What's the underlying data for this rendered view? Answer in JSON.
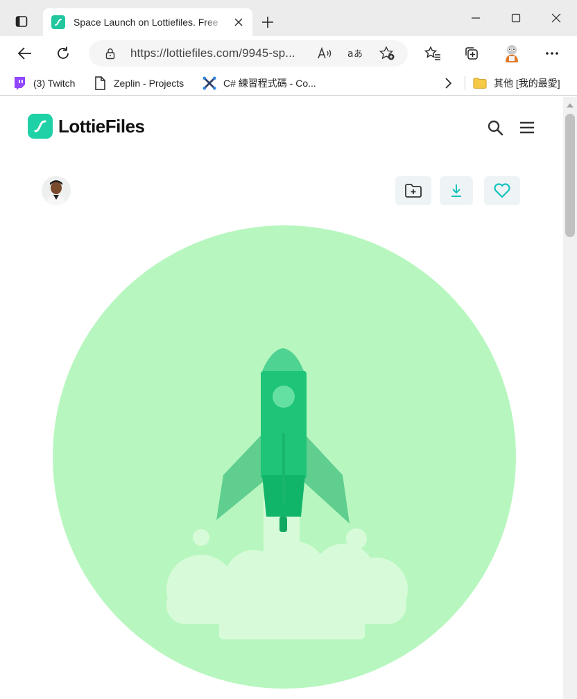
{
  "browser": {
    "tab_title": "Space Launch on Lottiefiles. Free",
    "url": "https://lottiefiles.com/9945-sp...",
    "read_aloud_label": "A̵",
    "translate_label": "aあ",
    "bookmarks": [
      {
        "label": "(3) Twitch",
        "icon": "twitch-icon"
      },
      {
        "label": "Zeplin - Projects",
        "icon": "document-icon"
      },
      {
        "label": "C# 練習程式碼 - Co...",
        "icon": "cross-logo-icon"
      }
    ],
    "other_favorites_label": "其他 [我的最愛]"
  },
  "site": {
    "logo_text": "LottieFiles"
  },
  "colors": {
    "brand": "#1fd1a6",
    "circle_bg": "#b7f7bf",
    "rocket_body": "#1ec477",
    "rocket_fins": "#55c98a",
    "smoke": "#d7fbd8"
  }
}
